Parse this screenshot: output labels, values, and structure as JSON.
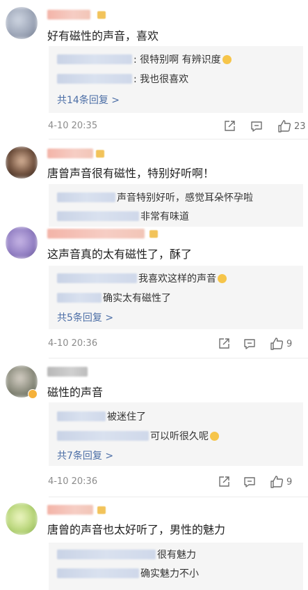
{
  "comments": [
    {
      "text": "好有磁性的声音，喜欢",
      "replies": [
        {
          "text": ": 很特别啊 有辨识度"
        },
        {
          "text": ": 我也很喜欢"
        }
      ],
      "more": "共14条回复 >",
      "date": "4-10 20:35",
      "likes": "23"
    },
    {
      "text": "唐曾声音很有磁性，特别好听啊！",
      "replies": [
        {
          "text": "声音特别好听，感觉耳朵怀孕啦"
        },
        {
          "text": "非常有味道"
        }
      ]
    },
    {
      "text": "这声音真的太有磁性了，酥了",
      "replies": [
        {
          "text": "我喜欢这样的声音"
        },
        {
          "text": "确实太有磁性了"
        }
      ],
      "more": "共5条回复 >",
      "date": "4-10 20:36",
      "likes": "9"
    },
    {
      "text": "磁性的声音",
      "replies": [
        {
          "text": "被迷住了"
        },
        {
          "text": "可以听很久呢"
        }
      ],
      "more": "共7条回复 >",
      "date": "4-10 20:36",
      "likes": "9"
    },
    {
      "text": "唐曾的声音也太好听了，男性的魅力",
      "replies": [
        {
          "text": "很有魅力"
        },
        {
          "text": "确实魅力不小"
        }
      ]
    }
  ],
  "icons": {
    "share": "share-icon",
    "comment": "comment-icon",
    "like": "thumbs-up-icon"
  },
  "colors": {
    "more_link": "#4c6ea6",
    "reply_bg": "#f5f5f5",
    "meta": "#8c8c8c"
  }
}
